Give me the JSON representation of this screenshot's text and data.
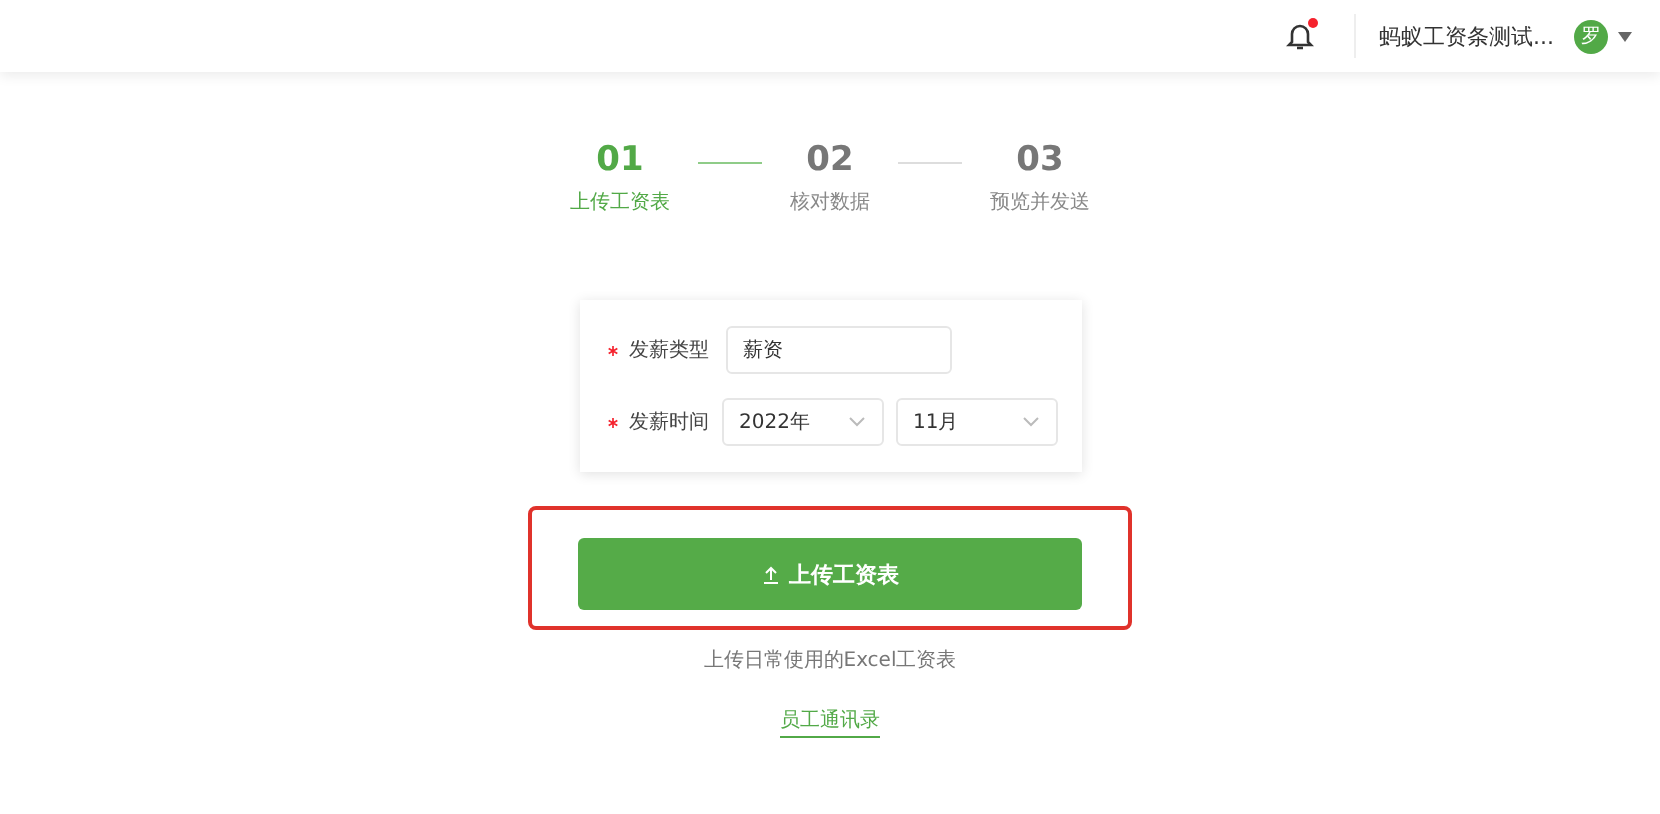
{
  "header": {
    "notification_unread": true,
    "company": "蚂蚁工资条测试...",
    "avatar": "罗"
  },
  "steps": [
    {
      "number": "01",
      "label": "上传工资表",
      "selected": true
    },
    {
      "number": "02",
      "label": "核对数据",
      "selected": false
    },
    {
      "number": "03",
      "label": "预览并发送",
      "selected": false
    }
  ],
  "form": {
    "fields": [
      {
        "kind": "input",
        "label": "发薪类型",
        "required": true,
        "value": "薪资"
      },
      {
        "kind": "selects",
        "label": "发薪时间",
        "required": true,
        "values": [
          "2022年",
          "11月"
        ]
      }
    ]
  },
  "upload_button": {
    "label": "上传工资表",
    "highlighted": true
  },
  "hint": "上传日常使用的Excel工资表",
  "link": "员工通讯录"
}
